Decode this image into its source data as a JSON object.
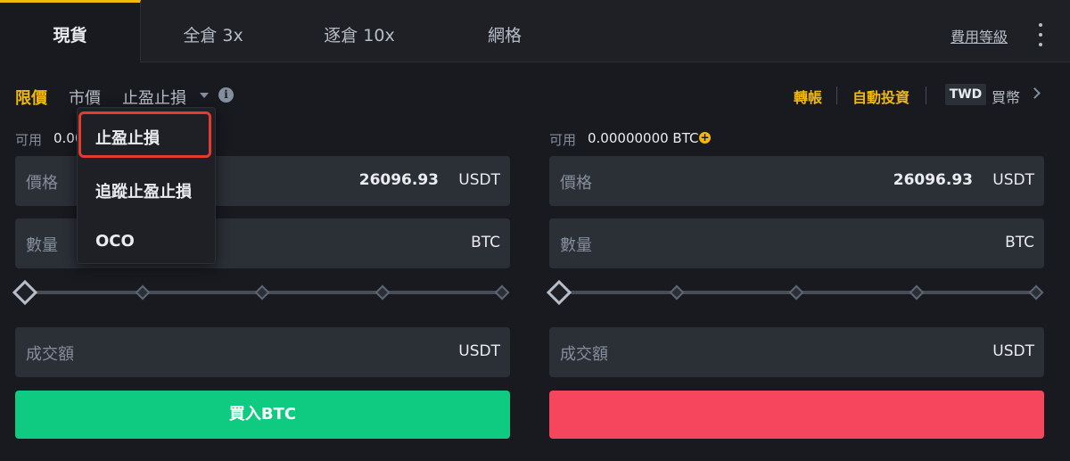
{
  "tabs": [
    {
      "label": "現貨",
      "active": true
    },
    {
      "label": "全倉 3x",
      "active": false
    },
    {
      "label": "逐倉 10x",
      "active": false
    },
    {
      "label": "網格",
      "active": false
    }
  ],
  "header": {
    "fee_link": "費用等級",
    "more_icon": "more-vertical-icon"
  },
  "order_types": {
    "limit": "限價",
    "market": "市價",
    "stop": "止盈止損",
    "caret_icon": "caret-down-icon",
    "info_icon": "info-icon",
    "info_glyph": "i"
  },
  "right_links": {
    "transfer": "轉帳",
    "auto_invest": "自動投資",
    "currency_badge": "TWD",
    "buy_coin": "買幣",
    "chevron_icon": "chevron-right-icon"
  },
  "buy_panel": {
    "avail_label": "可用",
    "avail_value": "0.00",
    "price_label": "價格",
    "price_value": "26096.93",
    "price_unit": "USDT",
    "amount_label": "數量",
    "amount_unit": "BTC",
    "total_label": "成交額",
    "total_unit": "USDT",
    "button_label": "買入BTC",
    "slider_percent": 0
  },
  "sell_panel": {
    "avail_label": "可用",
    "avail_value": "0.00000000 BTC",
    "price_label": "價格",
    "price_value": "26096.93",
    "price_unit": "USDT",
    "amount_label": "數量",
    "amount_unit": "BTC",
    "total_label": "成交額",
    "total_unit": "USDT",
    "button_label": "",
    "slider_percent": 0,
    "plus_icon": "plus-circle-icon",
    "plus_glyph": "+"
  },
  "dropdown": {
    "items": [
      "止盈止損",
      "追蹤止盈止損",
      "OCO"
    ],
    "highlighted_index": 0
  },
  "colors": {
    "accent": "#f0b90b",
    "buy": "#0ecb81",
    "sell": "#f6465d",
    "highlight": "#e53a2e",
    "background": "#181a20"
  }
}
